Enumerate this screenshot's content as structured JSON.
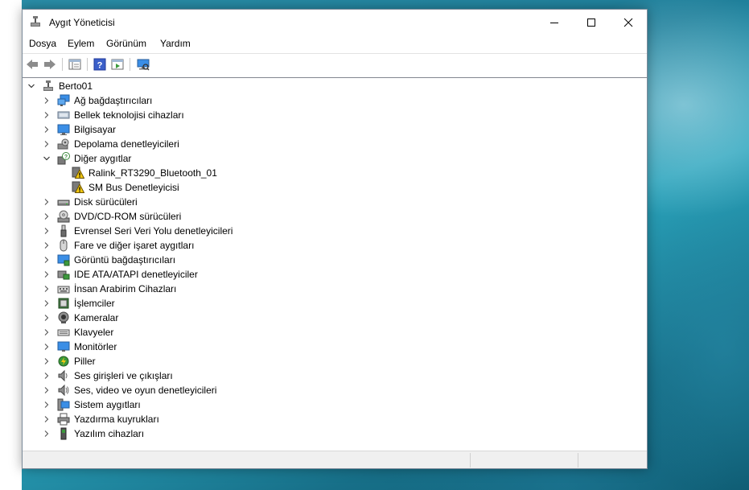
{
  "window": {
    "title": "Aygıt Yöneticisi"
  },
  "menu": [
    "Dosya",
    "Eylem",
    "Görünüm",
    "Yardım"
  ],
  "toolbar": {
    "buttons": [
      "back-icon",
      "forward-icon",
      "properties-icon",
      "help-icon",
      "update-driver-icon",
      "scan-hardware-icon"
    ]
  },
  "tree": {
    "root": {
      "label": "Berto01",
      "expanded": true
    },
    "categories": [
      {
        "label": "Ağ bağdaştırıcıları",
        "icon": "network-adapter-icon",
        "expanded": false
      },
      {
        "label": "Bellek teknolojisi cihazları",
        "icon": "memory-technology-icon",
        "expanded": false
      },
      {
        "label": "Bilgisayar",
        "icon": "computer-icon",
        "expanded": false
      },
      {
        "label": "Depolama denetleyicileri",
        "icon": "storage-controller-icon",
        "expanded": false
      },
      {
        "label": "Diğer aygıtlar",
        "icon": "other-devices-icon",
        "expanded": true,
        "children": [
          {
            "label": "Ralink_RT3290_Bluetooth_01",
            "icon": "warning-device-icon"
          },
          {
            "label": "SM Bus Denetleyicisi",
            "icon": "warning-device-icon"
          }
        ]
      },
      {
        "label": "Disk sürücüleri",
        "icon": "disk-drive-icon",
        "expanded": false
      },
      {
        "label": "DVD/CD-ROM sürücüleri",
        "icon": "dvd-drive-icon",
        "expanded": false
      },
      {
        "label": "Evrensel Seri Veri Yolu denetleyicileri",
        "icon": "usb-controller-icon",
        "expanded": false
      },
      {
        "label": "Fare ve diğer işaret aygıtları",
        "icon": "mouse-icon",
        "expanded": false
      },
      {
        "label": "Görüntü bağdaştırıcıları",
        "icon": "display-adapter-icon",
        "expanded": false
      },
      {
        "label": "IDE ATA/ATAPI denetleyiciler",
        "icon": "ide-controller-icon",
        "expanded": false
      },
      {
        "label": "İnsan Arabirim Cihazları",
        "icon": "hid-icon",
        "expanded": false
      },
      {
        "label": "İşlemciler",
        "icon": "processor-icon",
        "expanded": false
      },
      {
        "label": "Kameralar",
        "icon": "camera-icon",
        "expanded": false
      },
      {
        "label": "Klavyeler",
        "icon": "keyboard-icon",
        "expanded": false
      },
      {
        "label": "Monitörler",
        "icon": "monitor-icon",
        "expanded": false
      },
      {
        "label": "Piller",
        "icon": "battery-icon",
        "expanded": false
      },
      {
        "label": "Ses girişleri ve çıkışları",
        "icon": "audio-io-icon",
        "expanded": false
      },
      {
        "label": "Ses, video ve oyun denetleyicileri",
        "icon": "sound-controller-icon",
        "expanded": false
      },
      {
        "label": "Sistem aygıtları",
        "icon": "system-devices-icon",
        "expanded": false
      },
      {
        "label": "Yazdırma kuyrukları",
        "icon": "printer-icon",
        "expanded": false
      },
      {
        "label": "Yazılım cihazları",
        "icon": "software-device-icon",
        "expanded": false
      }
    ]
  },
  "colors": {
    "accent": "#0078d7",
    "warning": "#f2c811",
    "monitor_blue": "#3a8ee6"
  }
}
